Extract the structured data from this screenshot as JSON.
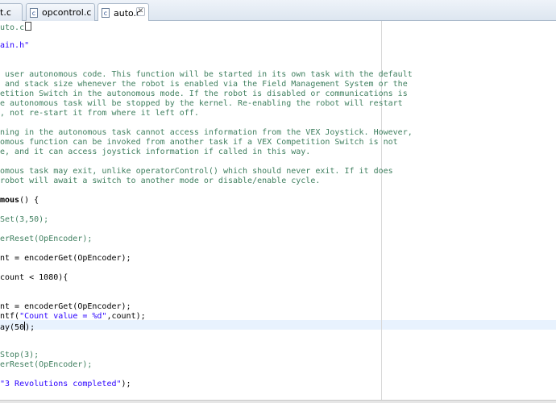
{
  "tabs": [
    {
      "label": "it.c",
      "icon": "c-file-icon",
      "icon_glyph": "c"
    },
    {
      "label": "opcontrol.c",
      "icon": "c-file-icon",
      "icon_glyph": "c"
    },
    {
      "label": "auto.c",
      "icon": "c-file-icon",
      "icon_glyph": "c",
      "active": true,
      "close_glyph": "✕"
    }
  ],
  "code": [
    {
      "parts": [
        {
          "t": "uto.c",
          "c": "cmt"
        }
      ],
      "marker": true
    },
    {
      "parts": []
    },
    {
      "parts": [
        {
          "t": "ain.h\"",
          "c": "str"
        }
      ]
    },
    {
      "parts": []
    },
    {
      "parts": []
    },
    {
      "parts": [
        {
          "t": " user autonomous code. This function will be started in its own task with the default",
          "c": "cmt"
        }
      ]
    },
    {
      "parts": [
        {
          "t": " and stack size whenever the robot is enabled via the Field Management System or the",
          "c": "cmt"
        }
      ]
    },
    {
      "parts": [
        {
          "t": "etition Switch in the autonomous mode. If the robot is disabled or communications is",
          "c": "cmt"
        }
      ]
    },
    {
      "parts": [
        {
          "t": "e autonomous task will be stopped by the kernel. Re-enabling the robot will restart",
          "c": "cmt"
        }
      ]
    },
    {
      "parts": [
        {
          "t": ", not re-start it from where it left off.",
          "c": "cmt"
        }
      ]
    },
    {
      "parts": []
    },
    {
      "parts": [
        {
          "t": "ning in the autonomous task cannot access information from the VEX Joystick. However,",
          "c": "cmt"
        }
      ]
    },
    {
      "parts": [
        {
          "t": "omous function can be invoked from another task if a VEX Competition Switch is not",
          "c": "cmt"
        }
      ]
    },
    {
      "parts": [
        {
          "t": "e, and it can access joystick information if called in this way.",
          "c": "cmt"
        }
      ]
    },
    {
      "parts": []
    },
    {
      "parts": [
        {
          "t": "omous task may exit, unlike operatorControl() which should never exit. If it does",
          "c": "cmt"
        }
      ]
    },
    {
      "parts": [
        {
          "t": "robot will await a switch to another mode or disable/enable cycle.",
          "c": "cmt"
        }
      ]
    },
    {
      "parts": []
    },
    {
      "parts": [
        {
          "t": "mous",
          "c": "bold"
        },
        {
          "t": "() {",
          "c": ""
        }
      ]
    },
    {
      "parts": []
    },
    {
      "parts": [
        {
          "t": "Set(3,50);",
          "c": "cmt"
        }
      ]
    },
    {
      "parts": []
    },
    {
      "parts": [
        {
          "t": "erReset(OpEncoder);",
          "c": "cmt"
        }
      ]
    },
    {
      "parts": []
    },
    {
      "parts": [
        {
          "t": "nt = encoderGet(OpEncoder);",
          "c": ""
        }
      ]
    },
    {
      "parts": []
    },
    {
      "parts": [
        {
          "t": "count < 1080){",
          "c": ""
        }
      ]
    },
    {
      "parts": []
    },
    {
      "parts": []
    },
    {
      "parts": [
        {
          "t": "nt = encoderGet(OpEncoder);",
          "c": ""
        }
      ]
    },
    {
      "parts": [
        {
          "t": "ntf(",
          "c": ""
        },
        {
          "t": "\"Count value = %d\"",
          "c": "str"
        },
        {
          "t": ",count);",
          "c": ""
        }
      ]
    },
    {
      "parts": [
        {
          "t": "ay(50",
          "c": ""
        },
        {
          "t": "|",
          "c": "cursor"
        },
        {
          "t": ");",
          "c": ""
        }
      ],
      "current": true
    },
    {
      "parts": []
    },
    {
      "parts": []
    },
    {
      "parts": [
        {
          "t": "Stop(3);",
          "c": "cmt"
        }
      ]
    },
    {
      "parts": [
        {
          "t": "erReset(OpEncoder);",
          "c": "cmt"
        }
      ]
    },
    {
      "parts": []
    },
    {
      "parts": [
        {
          "t": "\"3 Revolutions completed\"",
          "c": "str"
        },
        {
          "t": ");",
          "c": ""
        }
      ]
    }
  ]
}
